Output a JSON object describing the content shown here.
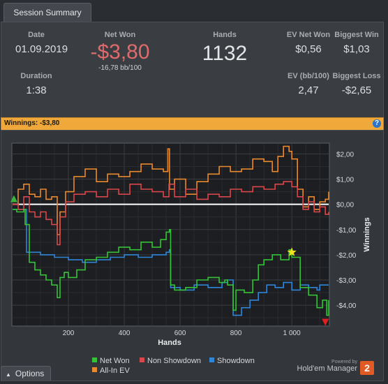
{
  "tab": {
    "label": "Session Summary"
  },
  "summary": {
    "date": {
      "label": "Date",
      "value": "01.09.2019"
    },
    "duration": {
      "label": "Duration",
      "value": "1:38"
    },
    "net_won": {
      "label": "Net Won",
      "value": "-$3,80",
      "sub": "-16,78 bb/100"
    },
    "hands": {
      "label": "Hands",
      "value": "1132"
    },
    "ev_net_won": {
      "label": "EV Net Won",
      "value": "$0,56"
    },
    "ev_bb100": {
      "label": "EV (bb/100)",
      "value": "2,47"
    },
    "biggest_win": {
      "label": "Biggest Win",
      "value": "$1,03"
    },
    "biggest_loss": {
      "label": "Biggest Loss",
      "value": "-$2,65"
    }
  },
  "banner": {
    "label": "Winnings:",
    "value": "-$3,80",
    "help": "?"
  },
  "chart_data": {
    "type": "line",
    "xlabel": "Hands",
    "ylabel": "Winnings",
    "xlim": [
      0,
      1132
    ],
    "ylim": [
      -4.8,
      2.4
    ],
    "x_ticks": [
      "200",
      "400",
      "600",
      "800",
      "1 000"
    ],
    "x_tick_values": [
      200,
      400,
      600,
      800,
      1000
    ],
    "y_ticks": [
      "$2,00",
      "$1,00",
      "$0,00",
      "-$1,00",
      "-$2,00",
      "-$3,00",
      "-$4,00"
    ],
    "y_tick_values": [
      2,
      1,
      0,
      -1,
      -2,
      -3,
      -4
    ],
    "grid": true,
    "legend_position": "bottom",
    "series": [
      {
        "name": "Net Won",
        "color": "#35c238",
        "x": [
          0,
          15,
          40,
          45,
          60,
          80,
          100,
          120,
          140,
          160,
          170,
          185,
          200,
          230,
          260,
          300,
          340,
          380,
          420,
          460,
          500,
          530,
          550,
          562,
          566,
          580,
          620,
          660,
          700,
          740,
          760,
          770,
          790,
          800,
          830,
          860,
          880,
          900,
          930,
          960,
          990,
          1000,
          1030,
          1060,
          1090,
          1110,
          1125,
          1132
        ],
        "y": [
          -0.2,
          -0.3,
          -0.2,
          -0.8,
          -2.3,
          -2.6,
          -2.8,
          -3.0,
          -3.2,
          -3.7,
          -2.9,
          -2.7,
          -2.9,
          -2.6,
          -2.2,
          -2.1,
          -1.9,
          -1.7,
          -1.8,
          -1.5,
          -1.7,
          -1.4,
          -1.1,
          -1.0,
          -3.2,
          -3.4,
          -3.3,
          -3.0,
          -2.9,
          -3.1,
          -3.0,
          -3.2,
          -4.2,
          -3.4,
          -3.5,
          -3.0,
          -2.4,
          -2.2,
          -2.0,
          -2.2,
          -1.8,
          -2.1,
          -3.3,
          -3.6,
          -4.1,
          -3.8,
          -4.4,
          -3.8
        ]
      },
      {
        "name": "Non Showdown",
        "color": "#d8484a",
        "x": [
          0,
          20,
          40,
          60,
          80,
          100,
          120,
          140,
          160,
          170,
          190,
          220,
          260,
          300,
          340,
          380,
          420,
          460,
          500,
          540,
          560,
          580,
          620,
          660,
          700,
          740,
          780,
          820,
          860,
          900,
          940,
          970,
          1000,
          1020,
          1040,
          1060,
          1080,
          1100,
          1120,
          1132
        ],
        "y": [
          0.0,
          -0.2,
          0.3,
          -0.3,
          -0.5,
          -0.3,
          -0.6,
          -0.8,
          -1.6,
          -0.5,
          0.1,
          0.4,
          0.5,
          0.3,
          0.6,
          0.4,
          0.8,
          0.6,
          0.5,
          0.3,
          0.8,
          0.3,
          0.6,
          0.2,
          0.4,
          0.3,
          0.6,
          0.5,
          0.7,
          0.6,
          0.8,
          0.9,
          0.7,
          0.3,
          -0.2,
          0.1,
          -0.3,
          -0.1,
          -0.4,
          -0.3
        ]
      },
      {
        "name": "Showdown",
        "color": "#2f86d8",
        "x": [
          0,
          40,
          50,
          100,
          150,
          200,
          250,
          300,
          350,
          400,
          450,
          500,
          550,
          562,
          566,
          600,
          650,
          700,
          750,
          770,
          790,
          820,
          850,
          880,
          910,
          940,
          970,
          1000,
          1030,
          1060,
          1090,
          1100,
          1132
        ],
        "y": [
          -0.2,
          -0.2,
          -1.9,
          -2.0,
          -2.1,
          -2.2,
          -2.3,
          -2.2,
          -2.1,
          -2.0,
          -2.1,
          -2.0,
          -1.9,
          -1.8,
          -3.3,
          -3.4,
          -3.2,
          -3.3,
          -3.1,
          -3.0,
          -4.4,
          -4.1,
          -3.8,
          -3.5,
          -3.2,
          -3.3,
          -3.1,
          -3.4,
          -3.2,
          -3.3,
          -3.4,
          -3.2,
          -3.2
        ]
      },
      {
        "name": "All-In EV",
        "color": "#e88a2e",
        "x": [
          0,
          20,
          40,
          60,
          80,
          100,
          120,
          140,
          160,
          170,
          190,
          220,
          260,
          300,
          340,
          380,
          420,
          460,
          500,
          540,
          556,
          562,
          580,
          620,
          660,
          700,
          740,
          780,
          820,
          860,
          900,
          930,
          950,
          970,
          990,
          1000,
          1020,
          1040,
          1060,
          1080,
          1100,
          1120,
          1132
        ],
        "y": [
          0.0,
          0.6,
          0.8,
          0.4,
          0.3,
          0.6,
          0.2,
          0.3,
          -1.2,
          -0.3,
          0.5,
          1.1,
          1.4,
          0.9,
          1.2,
          1.1,
          1.3,
          1.6,
          1.4,
          1.3,
          2.2,
          0.6,
          1.0,
          0.4,
          0.9,
          1.2,
          1.5,
          1.3,
          1.4,
          1.8,
          1.7,
          1.3,
          1.9,
          2.3,
          2.1,
          1.8,
          0.6,
          -0.1,
          0.3,
          -0.2,
          0.1,
          0.2,
          0.5
        ]
      }
    ],
    "markers": [
      {
        "name": "start-marker",
        "x": 5,
        "y": 0.2,
        "shape": "triangle-up",
        "color": "#3bb33f"
      },
      {
        "name": "best-marker",
        "x": 1000,
        "y": -1.9,
        "shape": "star",
        "color": "#f2e21c"
      },
      {
        "name": "worst-marker",
        "x": 1120,
        "y": -4.65,
        "shape": "triangle-down",
        "color": "#e02020"
      }
    ]
  },
  "legend": {
    "net_won": "Net Won",
    "non_showdown": "Non Showdown",
    "showdown": "Showdown",
    "all_in_ev": "All-In EV"
  },
  "footer": {
    "options": "Options",
    "powered_by": "Powered by",
    "brand": "Hold'em Manager",
    "brand_mark": "2"
  }
}
